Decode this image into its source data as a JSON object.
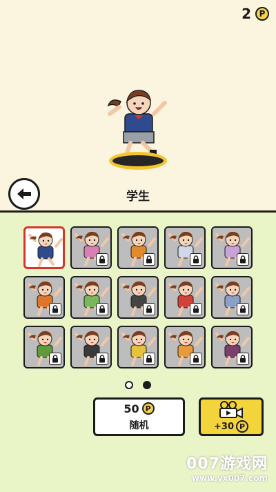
{
  "header": {
    "coin_count": "2",
    "coin_symbol": "P"
  },
  "preview": {
    "character_name": "学生"
  },
  "back_button": {
    "icon": "arrow-left-icon"
  },
  "characters": [
    {
      "selected": true,
      "locked": false,
      "outfit": "#2f4a8f"
    },
    {
      "selected": false,
      "locked": true,
      "outfit": "#d87fb4"
    },
    {
      "selected": false,
      "locked": true,
      "outfit": "#e28a2e"
    },
    {
      "selected": false,
      "locked": true,
      "outfit": "#cfd8e8"
    },
    {
      "selected": false,
      "locked": true,
      "outfit": "#c9a3d8"
    },
    {
      "selected": false,
      "locked": true,
      "outfit": "#e0752c"
    },
    {
      "selected": false,
      "locked": true,
      "outfit": "#78b85a"
    },
    {
      "selected": false,
      "locked": true,
      "outfit": "#444444"
    },
    {
      "selected": false,
      "locked": true,
      "outfit": "#d2423a"
    },
    {
      "selected": false,
      "locked": true,
      "outfit": "#8aa0c8"
    },
    {
      "selected": false,
      "locked": true,
      "outfit": "#5f9b3c"
    },
    {
      "selected": false,
      "locked": true,
      "outfit": "#3a3a3a"
    },
    {
      "selected": false,
      "locked": true,
      "outfit": "#e6c23a"
    },
    {
      "selected": false,
      "locked": true,
      "outfit": "#e99a3c"
    },
    {
      "selected": false,
      "locked": true,
      "outfit": "#7b3f6e"
    }
  ],
  "pagination": {
    "pages": 2,
    "current": 2
  },
  "random_button": {
    "price": "50",
    "coin_symbol": "P",
    "label": "随机"
  },
  "video_button": {
    "icon": "video-camera-icon",
    "reward": "+30",
    "coin_symbol": "P"
  },
  "watermark": {
    "main": "007游戏网",
    "url": "www.yx007.com"
  },
  "colors": {
    "top_bg": "#fbf4df",
    "bottom_bg": "#eaf5c7",
    "coin": "#f5d34b",
    "selected_border": "#d8352a",
    "video_button": "#f3d43b"
  }
}
